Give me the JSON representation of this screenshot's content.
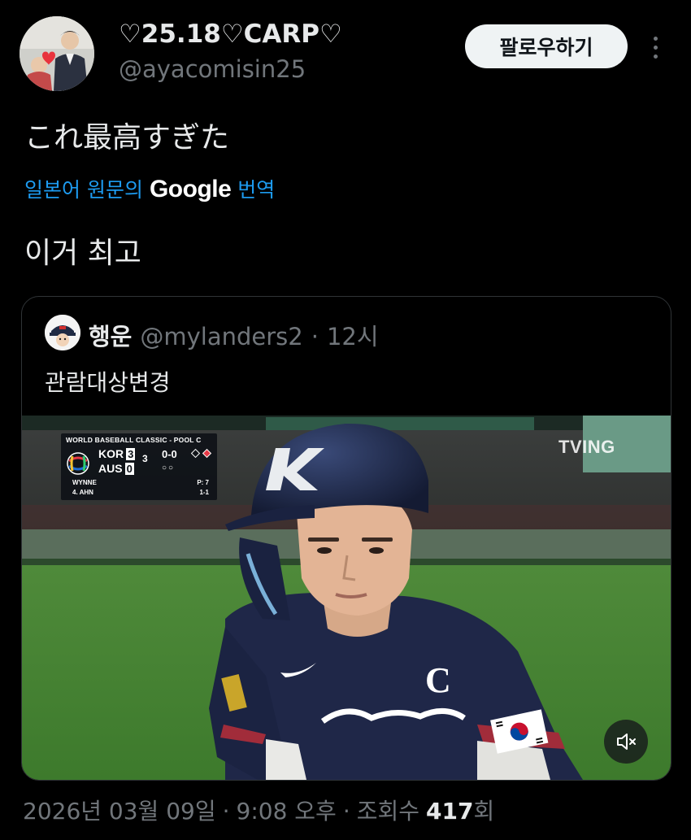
{
  "tweet": {
    "author": {
      "display_name": "♡25.18♡CARP♡",
      "handle": "@ayacomisin25",
      "avatar_icon": "profile-photo"
    },
    "follow_label": "팔로우하기",
    "more_icon": "more-vertical-icon",
    "text": "これ最高すぎた",
    "translation": {
      "prefix": "일본어 원문의",
      "provider": "Google",
      "suffix": "번역"
    },
    "translated_text": "이거 최고",
    "footer": {
      "date": "2026년 03월 09일",
      "sep1": "·",
      "time": "9:08 오후",
      "sep2": "·",
      "views_label": "조회수",
      "views_count": "417",
      "views_unit": "회"
    }
  },
  "quote": {
    "display_name": "행운",
    "handle": "@mylanders2",
    "dot": "·",
    "time": "12시",
    "text": "관람대상변경",
    "video": {
      "watermark": "TVING",
      "mute_icon": "volume-muted-icon",
      "scorebug": {
        "title": "WORLD BASEBALL CLASSIC - POOL C",
        "team1": "KOR",
        "score1": "3",
        "team2": "AUS",
        "score2": "0",
        "inning": "3",
        "count": "0-0",
        "outs": "○○",
        "pitcher": "WYNNE",
        "pitch_count": "P: 7",
        "batter": "4. AHN",
        "batter_line": "1-1"
      }
    }
  },
  "colors": {
    "background": "#000000",
    "text_primary": "#e7e9ea",
    "text_secondary": "#71767b",
    "link": "#1d9bf0",
    "follow_button_bg": "#eff3f4",
    "card_border": "#2f3336"
  }
}
